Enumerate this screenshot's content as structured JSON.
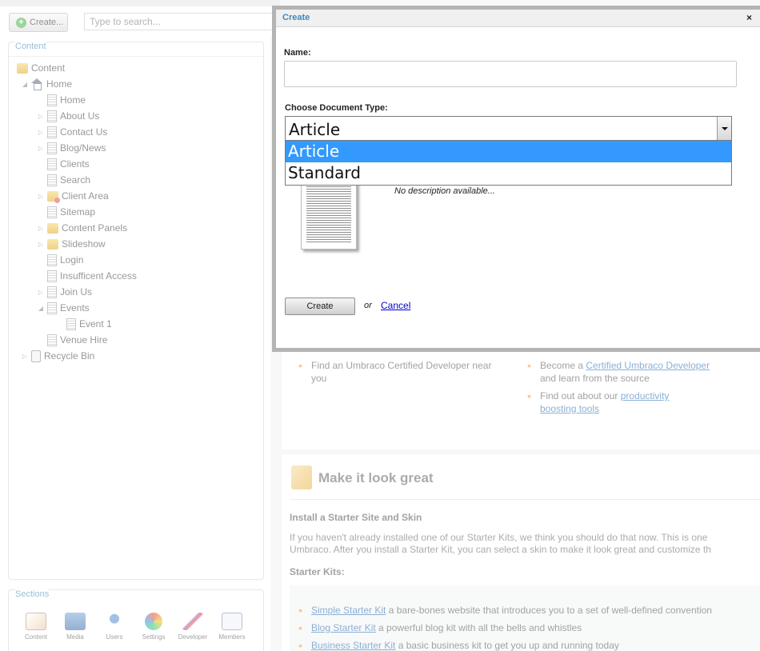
{
  "toolbar": {
    "create_label": "Create...",
    "search_placeholder": "Type to search..."
  },
  "content_panel": {
    "title": "Content",
    "tree": [
      {
        "label": "Content",
        "icon": "folder-icon"
      },
      {
        "label": "Home",
        "icon": "house-icon"
      },
      {
        "label": "Home",
        "icon": "document-icon"
      },
      {
        "label": "About Us",
        "icon": "document-icon"
      },
      {
        "label": "Contact Us",
        "icon": "document-icon"
      },
      {
        "label": "Blog/News",
        "icon": "document-icon"
      },
      {
        "label": "Clients",
        "icon": "document-icon"
      },
      {
        "label": "Search",
        "icon": "document-icon"
      },
      {
        "label": "Client Area",
        "icon": "locked-folder-icon"
      },
      {
        "label": "Sitemap",
        "icon": "document-icon"
      },
      {
        "label": "Content Panels",
        "icon": "folder-icon"
      },
      {
        "label": "Slideshow",
        "icon": "folder-icon"
      },
      {
        "label": "Login",
        "icon": "document-icon"
      },
      {
        "label": "Insufficent Access",
        "icon": "document-icon"
      },
      {
        "label": "Join Us",
        "icon": "document-icon"
      },
      {
        "label": "Events",
        "icon": "document-icon"
      },
      {
        "label": "Event 1",
        "icon": "document-icon"
      },
      {
        "label": "Venue Hire",
        "icon": "document-icon"
      },
      {
        "label": "Recycle Bin",
        "icon": "recycle-bin-icon"
      }
    ]
  },
  "sections_panel": {
    "title": "Sections",
    "items": [
      {
        "label": "Content",
        "icon": "content-section-icon"
      },
      {
        "label": "Media",
        "icon": "media-section-icon"
      },
      {
        "label": "Users",
        "icon": "users-section-icon"
      },
      {
        "label": "Settings",
        "icon": "settings-section-icon"
      },
      {
        "label": "Developer",
        "icon": "developer-section-icon"
      },
      {
        "label": "Members",
        "icon": "members-section-icon"
      }
    ]
  },
  "dashboard": {
    "left_bullet": "Find an Umbraco Certified Developer near you",
    "right_bullets": {
      "certified_prefix": "Become a ",
      "certified_link": "Certified Umbraco Developer",
      "certified_suffix": " and learn from the source",
      "tools_prefix": "Find out about our ",
      "tools_link": "productivity boosting tools"
    },
    "make_title": "Make it look great",
    "install_heading": "Install a Starter Site and Skin",
    "install_text_1": "If you haven't already installed one of our Starter Kits, we think you should do that now. This is one",
    "install_text_2": "Umbraco. After you install a Starter Kit, you can select a skin to make it look great and customize th",
    "kits_heading": "Starter Kits:",
    "kits": [
      {
        "link": "Simple Starter Kit",
        "text": " a bare-bones website that introduces you to a set of well-defined convention"
      },
      {
        "link": "Blog Starter Kit",
        "text": " a powerful blog kit with all the bells and whistles"
      },
      {
        "link": "Business Starter Kit",
        "text": " a basic business kit to get you up and running today"
      }
    ]
  },
  "modal": {
    "title": "Create",
    "close_label": "×",
    "name_label": "Name:",
    "name_value": "",
    "doctype_label": "Choose Document Type:",
    "doctype_selected": "Article",
    "doctype_options": [
      "Article",
      "Standard"
    ],
    "description": "No description available...",
    "create_button": "Create",
    "or_text": "or",
    "cancel_link": "Cancel"
  },
  "colors": {
    "accent": "#3d8ab8",
    "selection": "#3399ff",
    "link": "#0000cc",
    "bullet": "#f29a4a"
  }
}
